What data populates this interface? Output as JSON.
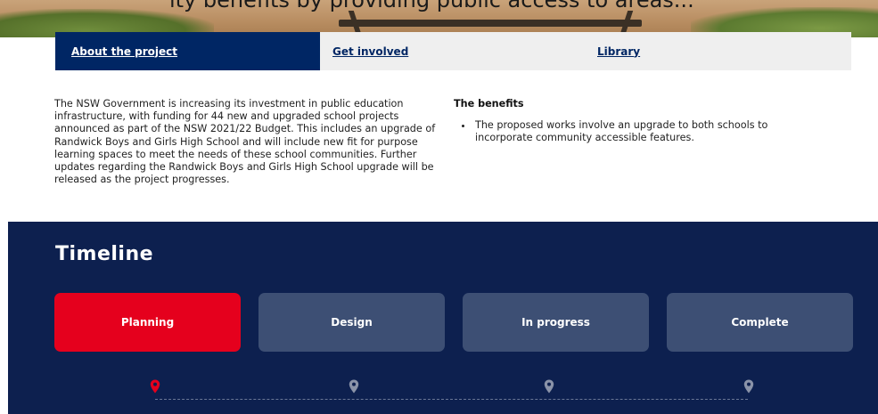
{
  "hero": {
    "caption": "ity benefits by providing public access to areas..."
  },
  "tabs": [
    {
      "label": "About the project",
      "active": true
    },
    {
      "label": "Get involved",
      "active": false
    },
    {
      "label": "Library",
      "active": false
    }
  ],
  "intro": {
    "paragraph": "The NSW Government is increasing its investment in public education infrastructure, with funding for 44 new and upgraded school projects announced as part of the NSW 2021/22 Budget. This includes an upgrade of Randwick Boys and Girls High School and will include new fit for purpose learning spaces to meet the needs of these school communities. Further updates regarding the Randwick Boys and Girls High School upgrade will be released as the project progresses."
  },
  "benefits": {
    "title": "The benefits",
    "items": [
      "The proposed works involve an upgrade to both schools to incorporate community accessible features."
    ]
  },
  "timeline": {
    "title": "Timeline",
    "stages": [
      {
        "label": "Planning",
        "active": true
      },
      {
        "label": "Design",
        "active": false
      },
      {
        "label": "In progress",
        "active": false
      },
      {
        "label": "Complete",
        "active": false
      }
    ]
  },
  "colors": {
    "navy": "#002664",
    "timeline_bg": "#0d204f",
    "active_red": "#e5001d",
    "inactive_stage": "#3d4f74",
    "tab_bg": "#efefef"
  },
  "icons": {
    "pins": [
      "map-pin-icon",
      "map-pin-icon",
      "map-pin-icon",
      "map-pin-icon"
    ]
  }
}
